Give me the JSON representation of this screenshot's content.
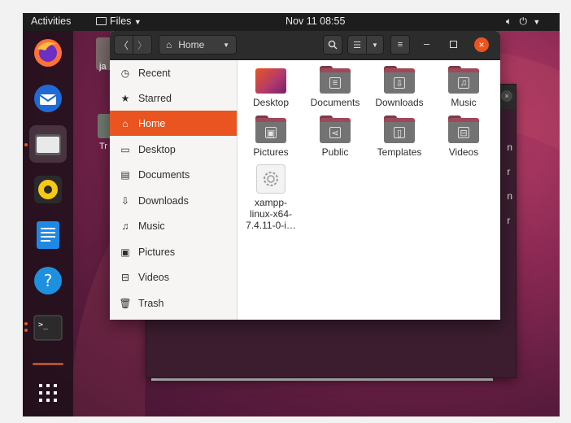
{
  "topbar": {
    "activities": "Activities",
    "app_menu": "Files",
    "clock": "Nov 11  08:55"
  },
  "desktop": {
    "icon1_label": "ja",
    "icon2_label": "Tr"
  },
  "bg_window_letters": [
    "n",
    "r",
    "n",
    "r"
  ],
  "window": {
    "location": "Home",
    "sidebar": [
      {
        "icon": "clock-icon",
        "label": "Recent"
      },
      {
        "icon": "star-icon",
        "label": "Starred"
      },
      {
        "icon": "home-icon",
        "label": "Home",
        "active": true
      },
      {
        "icon": "desktop-icon",
        "label": "Desktop"
      },
      {
        "icon": "document-icon",
        "label": "Documents"
      },
      {
        "icon": "download-icon",
        "label": "Downloads"
      },
      {
        "icon": "music-icon",
        "label": "Music"
      },
      {
        "icon": "picture-icon",
        "label": "Pictures"
      },
      {
        "icon": "video-icon",
        "label": "Videos"
      },
      {
        "icon": "trash-icon",
        "label": "Trash"
      }
    ],
    "items": [
      {
        "label": "Desktop",
        "icon": "desktop-folder-icon"
      },
      {
        "label": "Documents",
        "icon": "documents-folder-icon"
      },
      {
        "label": "Downloads",
        "icon": "downloads-folder-icon"
      },
      {
        "label": "Music",
        "icon": "music-folder-icon"
      },
      {
        "label": "Pictures",
        "icon": "pictures-folder-icon"
      },
      {
        "label": "Public",
        "icon": "public-folder-icon"
      },
      {
        "label": "Templates",
        "icon": "templates-folder-icon"
      },
      {
        "label": "Videos",
        "icon": "videos-folder-icon"
      },
      {
        "label_line1": "xampp-",
        "label_line2": "linux-x64-",
        "label_line3": "7.4.11-0-i…",
        "icon": "installer-file-icon"
      }
    ]
  },
  "colors": {
    "accent": "#e95420",
    "topbar": "#1d1d1d",
    "headerbar": "#2c2c2c",
    "close": "#e95420"
  }
}
